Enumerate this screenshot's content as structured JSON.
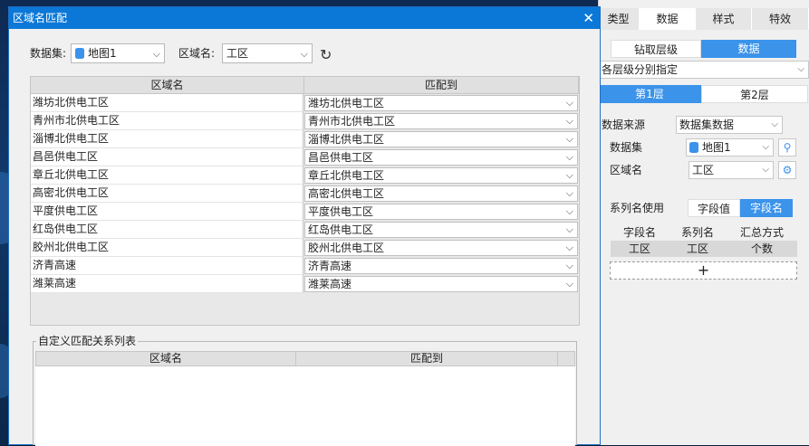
{
  "dialog": {
    "title": "区域名匹配",
    "dataset_label": "数据集:",
    "dataset_value": "地图1",
    "region_label": "区域名:",
    "region_value": "工区",
    "grid_headers": [
      "区域名",
      "匹配到"
    ],
    "rows": [
      {
        "name": "潍坊北供电工区",
        "match": "潍坊北供电工区"
      },
      {
        "name": "青州市北供电工区",
        "match": "青州市北供电工区"
      },
      {
        "name": "淄博北供电工区",
        "match": "淄博北供电工区"
      },
      {
        "name": "昌邑供电工区",
        "match": "昌邑供电工区"
      },
      {
        "name": "章丘北供电工区",
        "match": "章丘北供电工区"
      },
      {
        "name": "高密北供电工区",
        "match": "高密北供电工区"
      },
      {
        "name": "平度供电工区",
        "match": "平度供电工区"
      },
      {
        "name": "红岛供电工区",
        "match": "红岛供电工区"
      },
      {
        "name": "胶州北供电工区",
        "match": "胶州北供电工区"
      },
      {
        "name": "济青高速",
        "match": "济青高速"
      },
      {
        "name": "潍莱高速",
        "match": "潍莱高速"
      }
    ],
    "custom_legend": "自定义匹配关系列表",
    "custom_headers": [
      "区域名",
      "匹配到"
    ]
  },
  "panel": {
    "tabs": [
      "类型",
      "数据",
      "样式",
      "特效"
    ],
    "drill_seg": [
      "钻取层级",
      "数据"
    ],
    "level_mode": "各层级分别指定",
    "level_seg": [
      "第1层",
      "第2层"
    ],
    "source_label": "数据来源",
    "source_value": "数据集数据",
    "dataset_label": "数据集",
    "dataset_value": "地图1",
    "region_label": "区域名",
    "region_value": "工区",
    "series_label": "系列名使用",
    "series_seg": [
      "字段值",
      "字段名"
    ],
    "field_headers": [
      "字段名",
      "系列名",
      "汇总方式"
    ],
    "field_row": [
      "工区",
      "工区",
      "个数"
    ],
    "add_label": "+"
  },
  "colors": {
    "accent": "#3b93ea",
    "titlebar": "#0b78d7"
  }
}
